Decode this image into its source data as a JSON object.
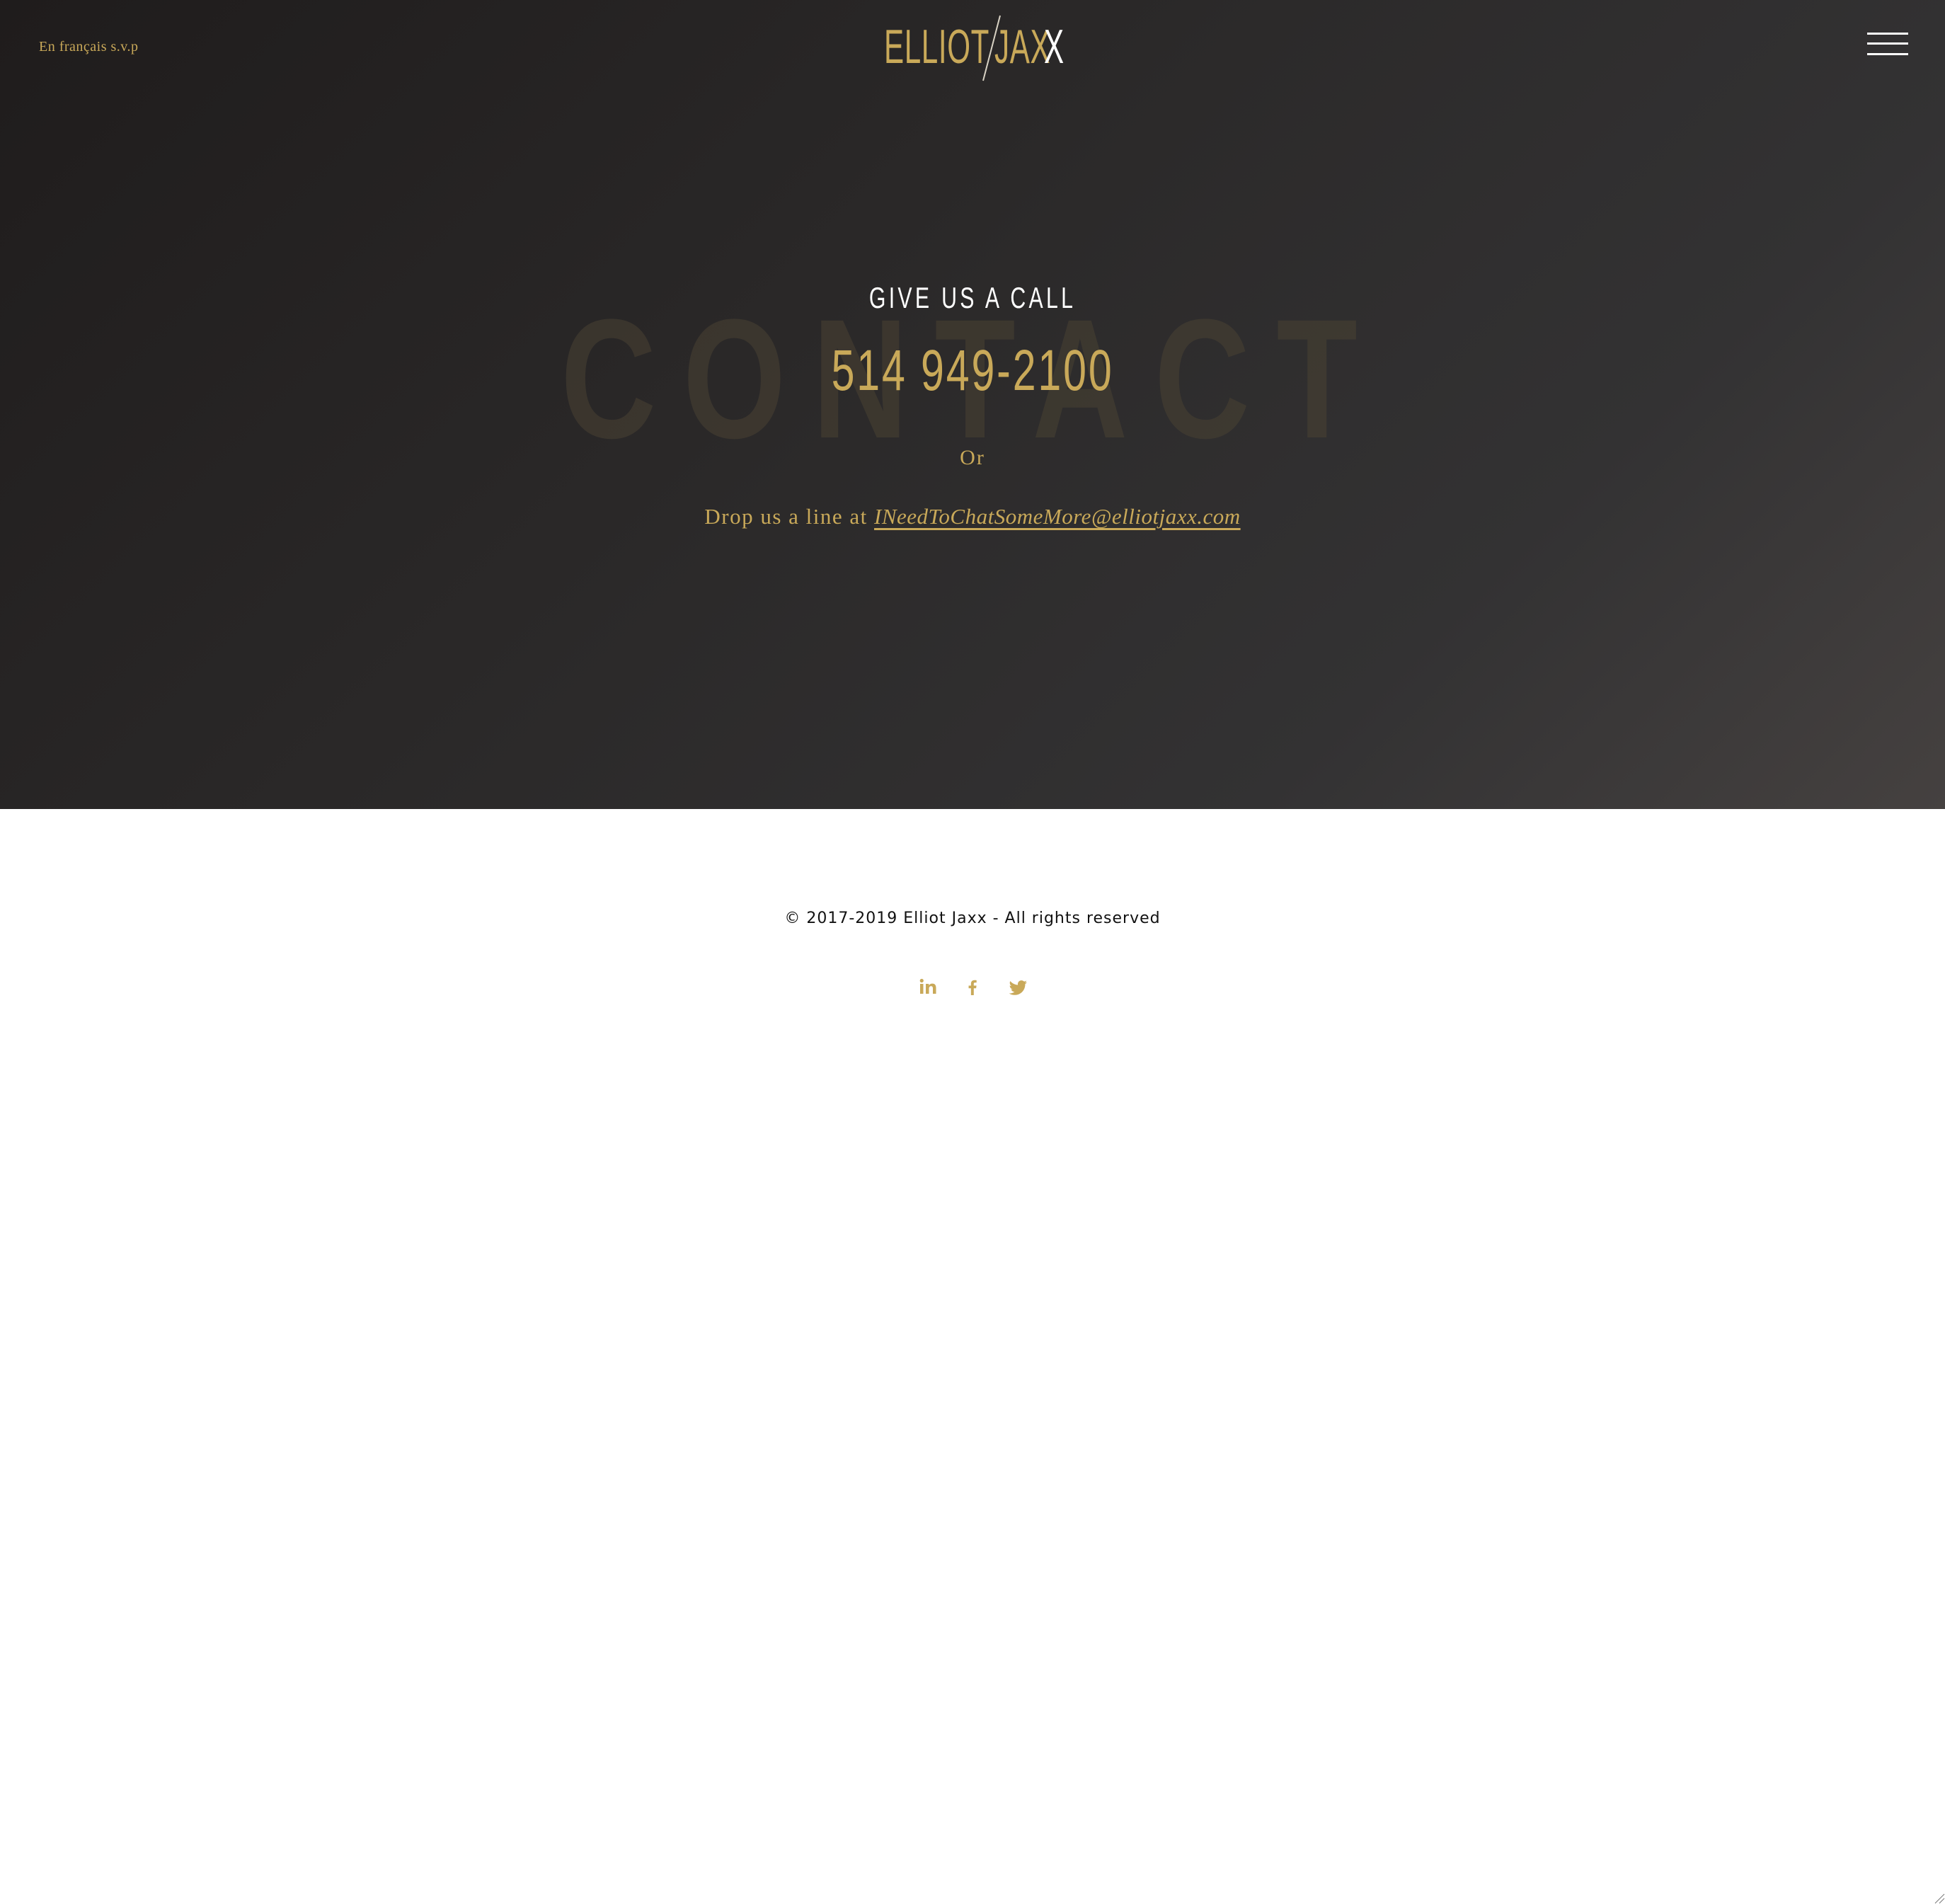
{
  "header": {
    "language_link": "En français s.v.p",
    "logo": {
      "elliot": "ELLIOT",
      "jax": "JAX",
      "x": "X"
    },
    "menu_icon": "hamburger-icon"
  },
  "contact": {
    "background_word": "CONTACT",
    "heading": "GIVE US A CALL",
    "phone": "514 949-2100",
    "or": "Or",
    "drop_line_prefix": "Drop us a line at",
    "email": "INeedToChatSomeMore@elliotjaxx.com"
  },
  "footer": {
    "copyright": "© 2017-2019 Elliot Jaxx - All rights reserved",
    "social": [
      {
        "icon": "linkedin-icon"
      },
      {
        "icon": "facebook-icon"
      },
      {
        "icon": "twitter-icon"
      }
    ]
  },
  "colors": {
    "accent_gold": "#c9a959",
    "hero_dark": "#2a2828",
    "footer_bg": "#ffffff"
  }
}
